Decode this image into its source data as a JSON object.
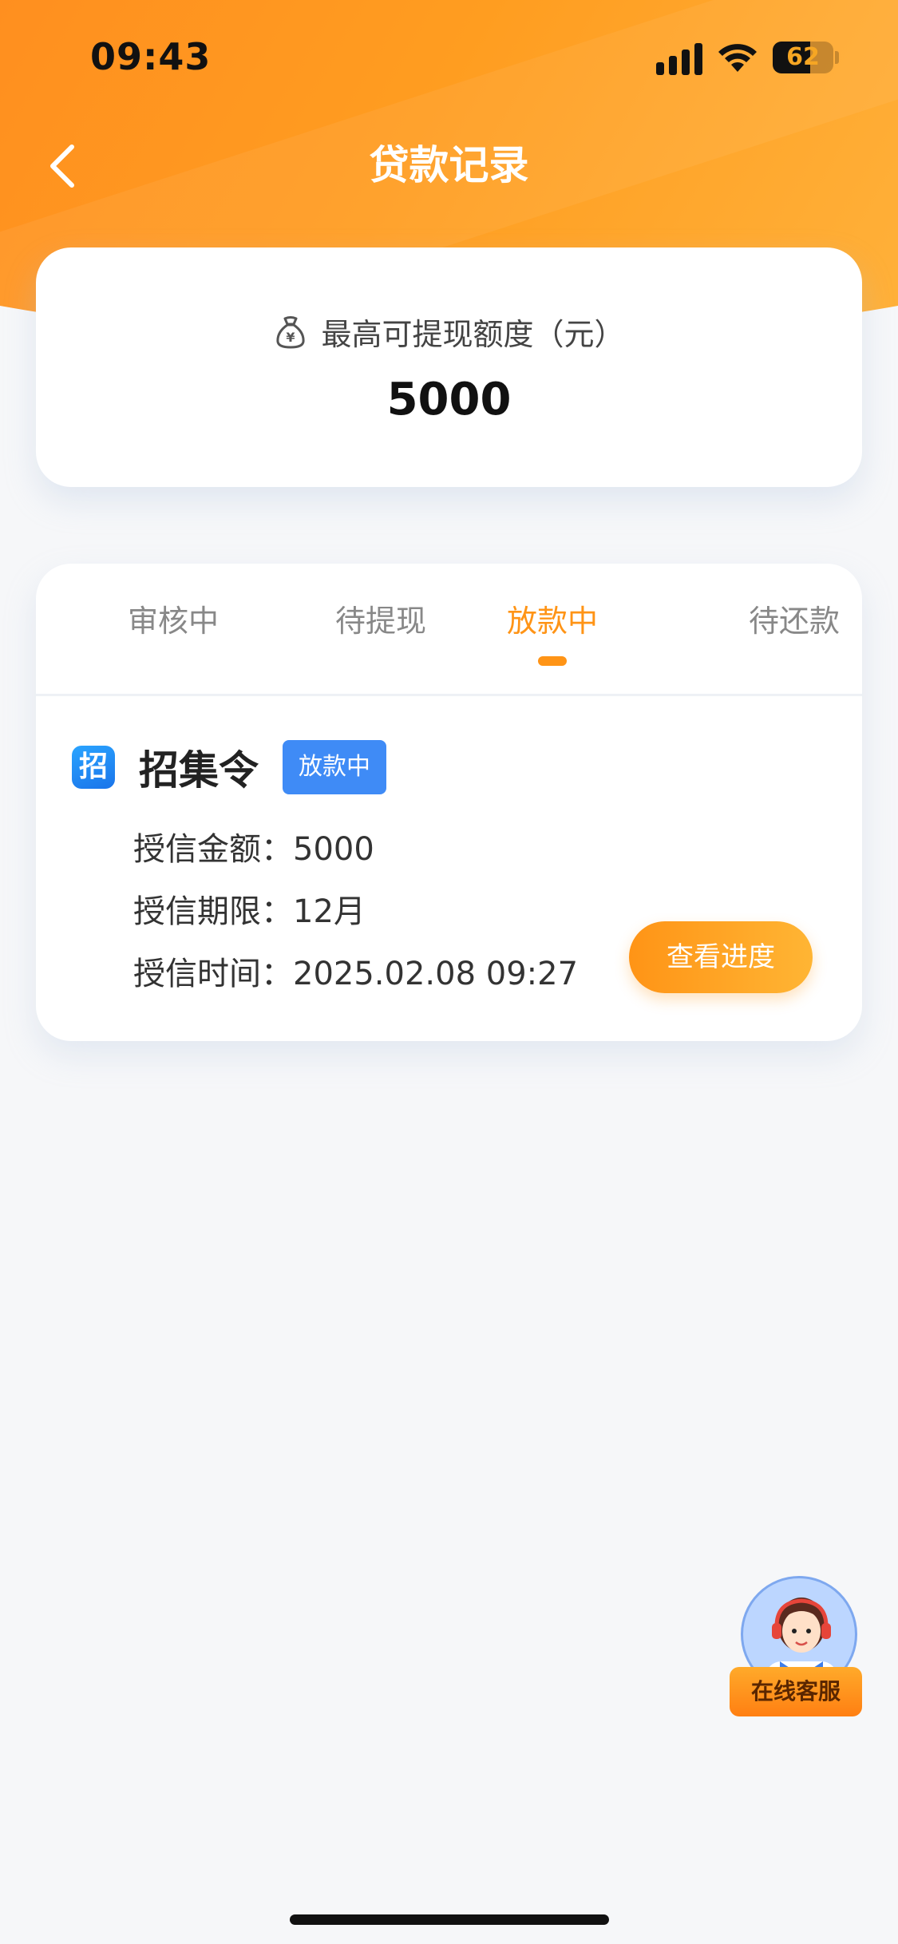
{
  "status_bar": {
    "time": "09:43",
    "battery": "62",
    "battery_level": 0.62
  },
  "nav": {
    "title": "贷款记录"
  },
  "quota": {
    "label": "最高可提现额度（元）",
    "value": "5000"
  },
  "tabs": [
    {
      "label": "审核中",
      "active": false
    },
    {
      "label": "待提现",
      "active": false
    },
    {
      "label": "放款中",
      "active": true
    },
    {
      "label": "待还款",
      "active": false
    }
  ],
  "record": {
    "logo_char": "招",
    "name": "招集令",
    "status": "放款中",
    "rows": [
      {
        "label": "授信金额：",
        "value": "5000"
      },
      {
        "label": "授信期限：",
        "value": "12月"
      },
      {
        "label": "授信时间：",
        "value": "2025.02.08 09:27"
      }
    ],
    "button": "查看进度"
  },
  "customer_service": {
    "label": "在线客服"
  },
  "colors": {
    "accent": "#ff9416",
    "badge_blue": "#3f8bf6",
    "header_orange": "#ff9d20"
  },
  "icons": [
    "back-arrow-icon",
    "money-bag-icon",
    "signal-icon",
    "wifi-icon",
    "battery-icon",
    "brand-logo-icon",
    "customer-service-avatar-icon"
  ]
}
